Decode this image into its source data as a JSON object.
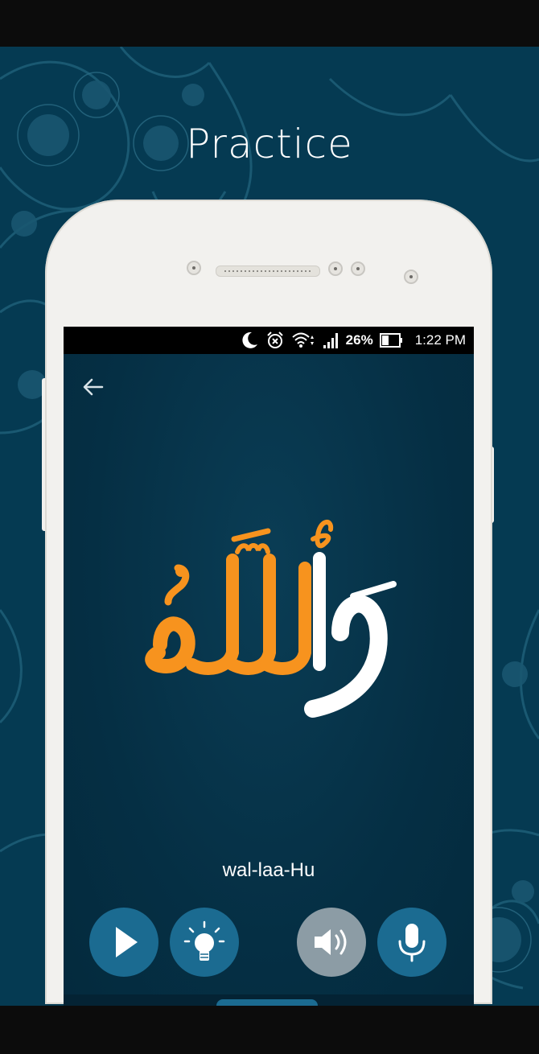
{
  "promo": {
    "title": "Practice"
  },
  "status_bar": {
    "battery": "26%",
    "time": "1:22 PM",
    "icons": [
      "moon-icon",
      "alarm-icon",
      "wifi-icon",
      "signal-icon",
      "battery-icon"
    ]
  },
  "screen": {
    "back_icon": "arrow-left-icon",
    "arabic_word": "وَٱللَّهُ",
    "transliteration": "wal-laa-Hu",
    "controls": [
      {
        "name": "play-button",
        "icon": "play-icon"
      },
      {
        "name": "hint-button",
        "icon": "lightbulb-icon"
      },
      {
        "name": "speaker-button",
        "icon": "volume-icon",
        "state": "disabled"
      },
      {
        "name": "record-button",
        "icon": "microphone-icon"
      }
    ]
  },
  "colors": {
    "background": "#053a52",
    "screen": "#052f44",
    "accent_orange": "#f7931e",
    "button_blue": "#1b6b91",
    "button_grey": "#8c9ca5"
  }
}
